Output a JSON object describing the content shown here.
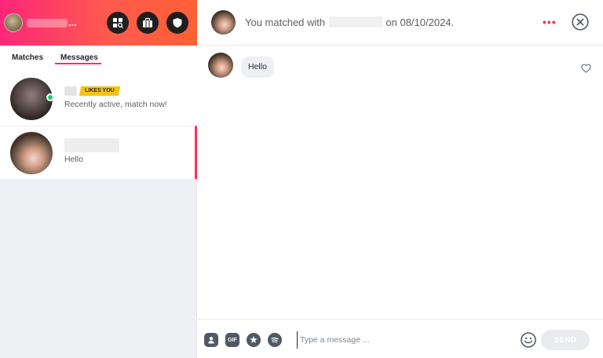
{
  "header_bar": {
    "profile_name_ellipsis": "...",
    "icons": [
      "explore-icon",
      "briefcase-icon",
      "shield-icon"
    ]
  },
  "tabs": [
    {
      "label": "Matches",
      "active": false
    },
    {
      "label": "Messages",
      "active": true
    }
  ],
  "conversations": [
    {
      "badge": "LIKES YOU",
      "subtitle": "Recently active, match now!",
      "online": true
    },
    {
      "subtitle": "Hello",
      "active": true
    }
  ],
  "chat": {
    "match_prefix": "You matched with",
    "match_suffix": "on 08/10/2024.",
    "more_label": "•••",
    "messages": [
      {
        "text": "Hello",
        "from": "them"
      }
    ]
  },
  "composer": {
    "gif_label": "GIF",
    "placeholder": "Type a message ...",
    "send_label": "SEND"
  },
  "colors": {
    "brand_gradient_start": "#fd267a",
    "brand_gradient_end": "#ff6036",
    "accent": "#fd2e5e",
    "online": "#1ec974",
    "badge": "#f6c218"
  }
}
